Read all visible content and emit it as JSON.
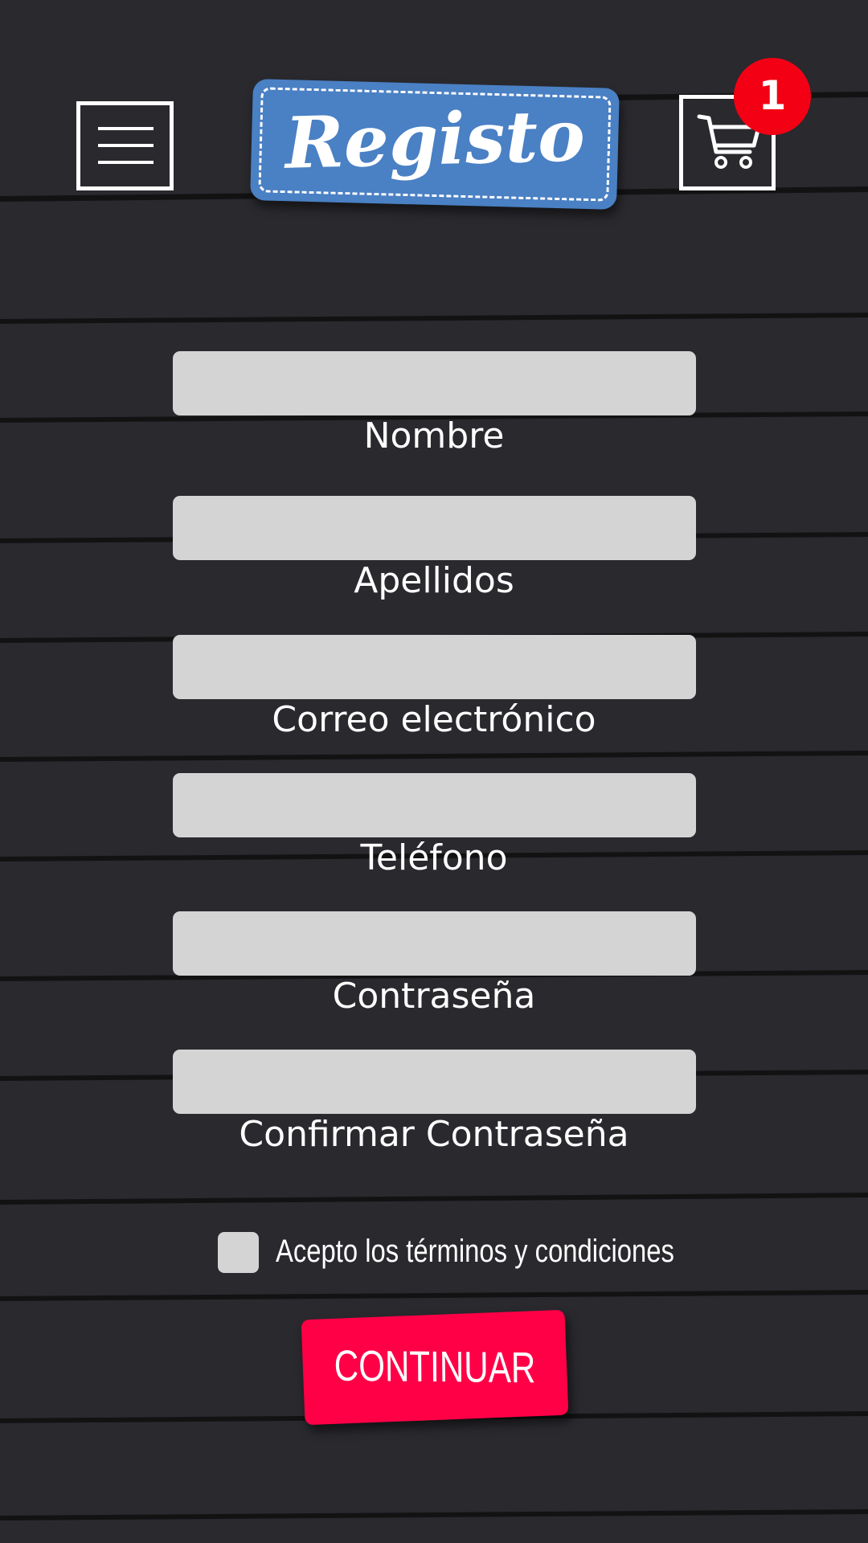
{
  "header": {
    "title": "Registo",
    "menu_icon": "hamburger-menu-icon",
    "cart_icon": "shopping-cart-icon",
    "cart_count": "1"
  },
  "form": {
    "fields": [
      {
        "label": "Nombre",
        "value": ""
      },
      {
        "label": "Apellidos",
        "value": ""
      },
      {
        "label": "Correo electrónico",
        "value": ""
      },
      {
        "label": "Teléfono",
        "value": ""
      },
      {
        "label": "Contraseña",
        "value": ""
      },
      {
        "label": "Confirmar Contraseña",
        "value": ""
      }
    ],
    "terms_label": "Acepto los términos y condiciones",
    "terms_checked": false,
    "submit_label": "CONTINUAR"
  },
  "colors": {
    "background": "#29292e",
    "logo": "#4a80c4",
    "accent": "#ff0047",
    "badge": "#f30015",
    "input": "#d4d4d4"
  }
}
